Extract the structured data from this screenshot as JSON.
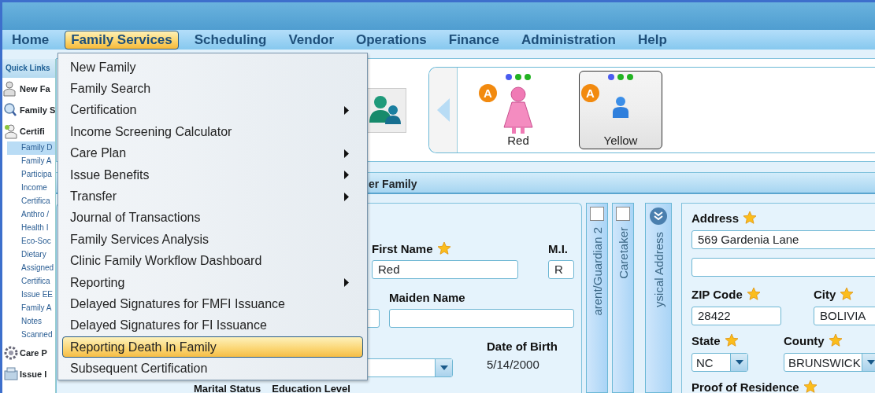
{
  "menu_bar": [
    {
      "label": "Home",
      "selected": false
    },
    {
      "label": "Family Services",
      "selected": true
    },
    {
      "label": "Scheduling",
      "selected": false
    },
    {
      "label": "Vendor",
      "selected": false
    },
    {
      "label": "Operations",
      "selected": false
    },
    {
      "label": "Finance",
      "selected": false
    },
    {
      "label": "Administration",
      "selected": false
    },
    {
      "label": "Help",
      "selected": false
    }
  ],
  "sidebar": {
    "title": "Quick Links",
    "items": [
      {
        "label": "New Fa"
      },
      {
        "label": "Family S"
      },
      {
        "label": "Certifi",
        "children": [
          {
            "label": "Family D",
            "selected": true
          },
          {
            "label": "Family A",
            "selected": false
          },
          {
            "label": "Participa",
            "selected": false
          },
          {
            "label": "Income",
            "selected": false
          },
          {
            "label": "Certifica",
            "selected": false
          },
          {
            "label": "Anthro /",
            "selected": false
          },
          {
            "label": "Health I",
            "selected": false
          },
          {
            "label": "Eco-Soc",
            "selected": false
          },
          {
            "label": "Dietary",
            "selected": false
          },
          {
            "label": "Assigned",
            "selected": false
          },
          {
            "label": "Certifica",
            "selected": false
          },
          {
            "label": "Issue EE",
            "selected": false
          },
          {
            "label": "Family A",
            "selected": false
          },
          {
            "label": "Notes",
            "selected": false
          },
          {
            "label": "Scanned",
            "selected": false
          }
        ]
      },
      {
        "label": "Care P"
      },
      {
        "label": "Issue I"
      }
    ]
  },
  "dropdown": [
    {
      "label": "New Family",
      "submenu": false,
      "selected": false
    },
    {
      "label": "Family Search",
      "submenu": false,
      "selected": false
    },
    {
      "label": "Certification",
      "submenu": true,
      "selected": false
    },
    {
      "label": "Income Screening Calculator",
      "submenu": false,
      "selected": false
    },
    {
      "label": "Care Plan",
      "submenu": true,
      "selected": false
    },
    {
      "label": "Issue Benefits",
      "submenu": true,
      "selected": false
    },
    {
      "label": "Transfer",
      "submenu": true,
      "selected": false
    },
    {
      "label": "Journal of Transactions",
      "submenu": false,
      "selected": false
    },
    {
      "label": "Family Services Analysis",
      "submenu": false,
      "selected": false
    },
    {
      "label": "Clinic Family Workflow Dashboard",
      "submenu": false,
      "selected": false
    },
    {
      "label": "Reporting",
      "submenu": true,
      "selected": false
    },
    {
      "label": "Delayed Signatures for FMFI Issuance",
      "submenu": false,
      "selected": false
    },
    {
      "label": "Delayed Signatures for FI Issuance",
      "submenu": false,
      "selected": false
    },
    {
      "label": "Reporting Death In Family",
      "submenu": false,
      "selected": true
    },
    {
      "label": "Subsequent Certification",
      "submenu": false,
      "selected": false
    }
  ],
  "family_members": [
    {
      "name": "Red",
      "kind": "female",
      "badge": "A",
      "selected": false,
      "dots": [
        {
          "color": "#4a5cf0"
        },
        {
          "color": "#22b322"
        },
        {
          "color": "#22b322"
        }
      ]
    },
    {
      "name": "Yellow",
      "kind": "child",
      "badge": "A",
      "selected": true,
      "dots": [
        {
          "color": "#4a5cf0"
        },
        {
          "color": "#22b322"
        },
        {
          "color": "#22b322"
        }
      ]
    }
  ],
  "section_header": "er Family",
  "form": {
    "fields": [
      {
        "label": "First Name",
        "required": true,
        "kind": "input",
        "value": "Red"
      },
      {
        "label": "M.I.",
        "kind": "input",
        "value": "R"
      },
      {
        "kind": "input"
      },
      {
        "label": "Maiden Name",
        "kind": "input"
      },
      {
        "kind": "select"
      },
      {
        "label": "Date of Birth",
        "kind": "static",
        "value": "5/14/2000"
      }
    ],
    "bottom_labels": [
      "Marital Status",
      "Education Level"
    ]
  },
  "vertical_tabs": [
    {
      "label": "arent/Guardian 2",
      "kind": "checkbox",
      "checked": false
    },
    {
      "label": "Caretaker",
      "kind": "checkbox",
      "checked": false
    },
    {
      "label": "ysical Address",
      "kind": "expander"
    }
  ],
  "address": {
    "fields": [
      {
        "label": "Address",
        "required": true,
        "kind": "input",
        "value": "569 Gardenia Lane"
      },
      {
        "kind": "input"
      },
      {
        "label": "ZIP Code",
        "required": true,
        "kind": "input",
        "value": "28422"
      },
      {
        "label": "City",
        "required": true,
        "kind": "input",
        "value": "BOLIVIA"
      },
      {
        "label": "State",
        "required": true,
        "kind": "select",
        "value": "NC"
      },
      {
        "label": "County",
        "required": true,
        "kind": "select",
        "value": "BRUNSWICK"
      },
      {
        "label": "Proof of Residence",
        "required": true,
        "kind": "label"
      }
    ]
  }
}
